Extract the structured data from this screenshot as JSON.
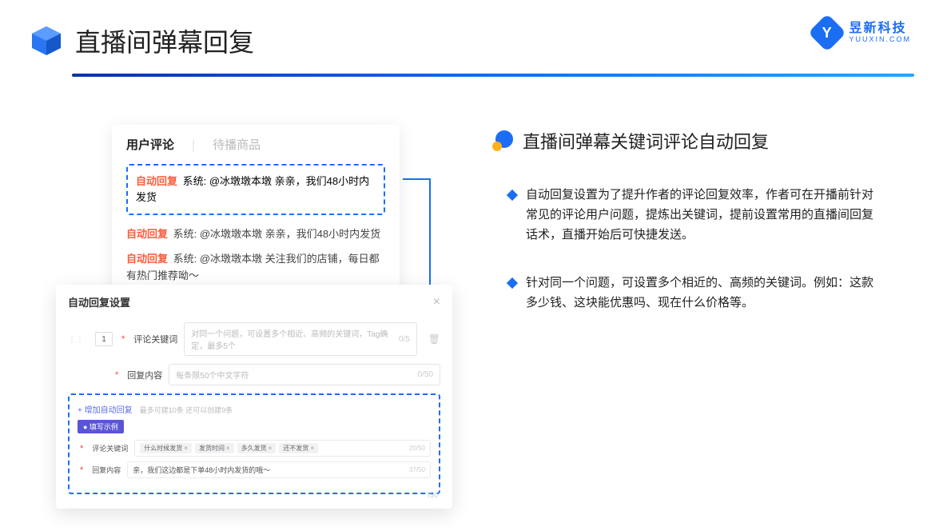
{
  "header": {
    "title": "直播间弹幕回复"
  },
  "brand": {
    "cn": "昱新科技",
    "en": "YUUXIN.COM",
    "letter": "Y"
  },
  "commentCard": {
    "tab1": "用户评论",
    "tab2": "待播商品",
    "highlighted": {
      "tag": "自动回复",
      "text": " 系统: @冰墩墩本墩 亲亲，我们48小时内发货"
    },
    "line2_tag": "自动回复",
    "line2_text": " 系统: @冰墩墩本墩 亲亲，我们48小时内发货",
    "line3_tag": "自动回复",
    "line3_text": " 系统: @冰墩墩本墩 关注我们的店铺，每日都有热门推荐呦～"
  },
  "settings": {
    "title": "自动回复设置",
    "rowNum": "1",
    "kwLabel": "评论关键词",
    "kwPlaceholder": "对同一个问题，可设置多个相近、高频的关键词，Tag确定，最多5个",
    "kwCounter": "0/5",
    "replyLabel": "回复内容",
    "replyPlaceholder": "每条限50个中文字符",
    "replyCounter": "0/50",
    "addLink": "+ 增加自动回复",
    "addDesc": "最多可建10条 还可以创建9条",
    "exampleBadge": "● 填写示例",
    "exKwLabel": "评论关键词",
    "exTags": [
      "什么时候发货",
      "发货时间",
      "多久发货",
      "还不发货"
    ],
    "exKwCounter": "20/50",
    "exReplyLabel": "回复内容",
    "exReplyText": "亲，我们这边都是下单48小时内发货的哦～",
    "exReplyCounter": "37/50",
    "bottomCounter": "/50"
  },
  "right": {
    "title": "直播间弹幕关键词评论自动回复",
    "bullet1": "自动回复设置为了提升作者的评论回复效率，作者可在开播前针对常见的评论用户问题，提炼出关键词，提前设置常用的直播间回复话术，直播开始后可快捷发送。",
    "bullet2": "针对同一个问题，可设置多个相近的、高频的关键词。例如：这款多少钱、这块能优惠吗、现在什么价格等。"
  }
}
